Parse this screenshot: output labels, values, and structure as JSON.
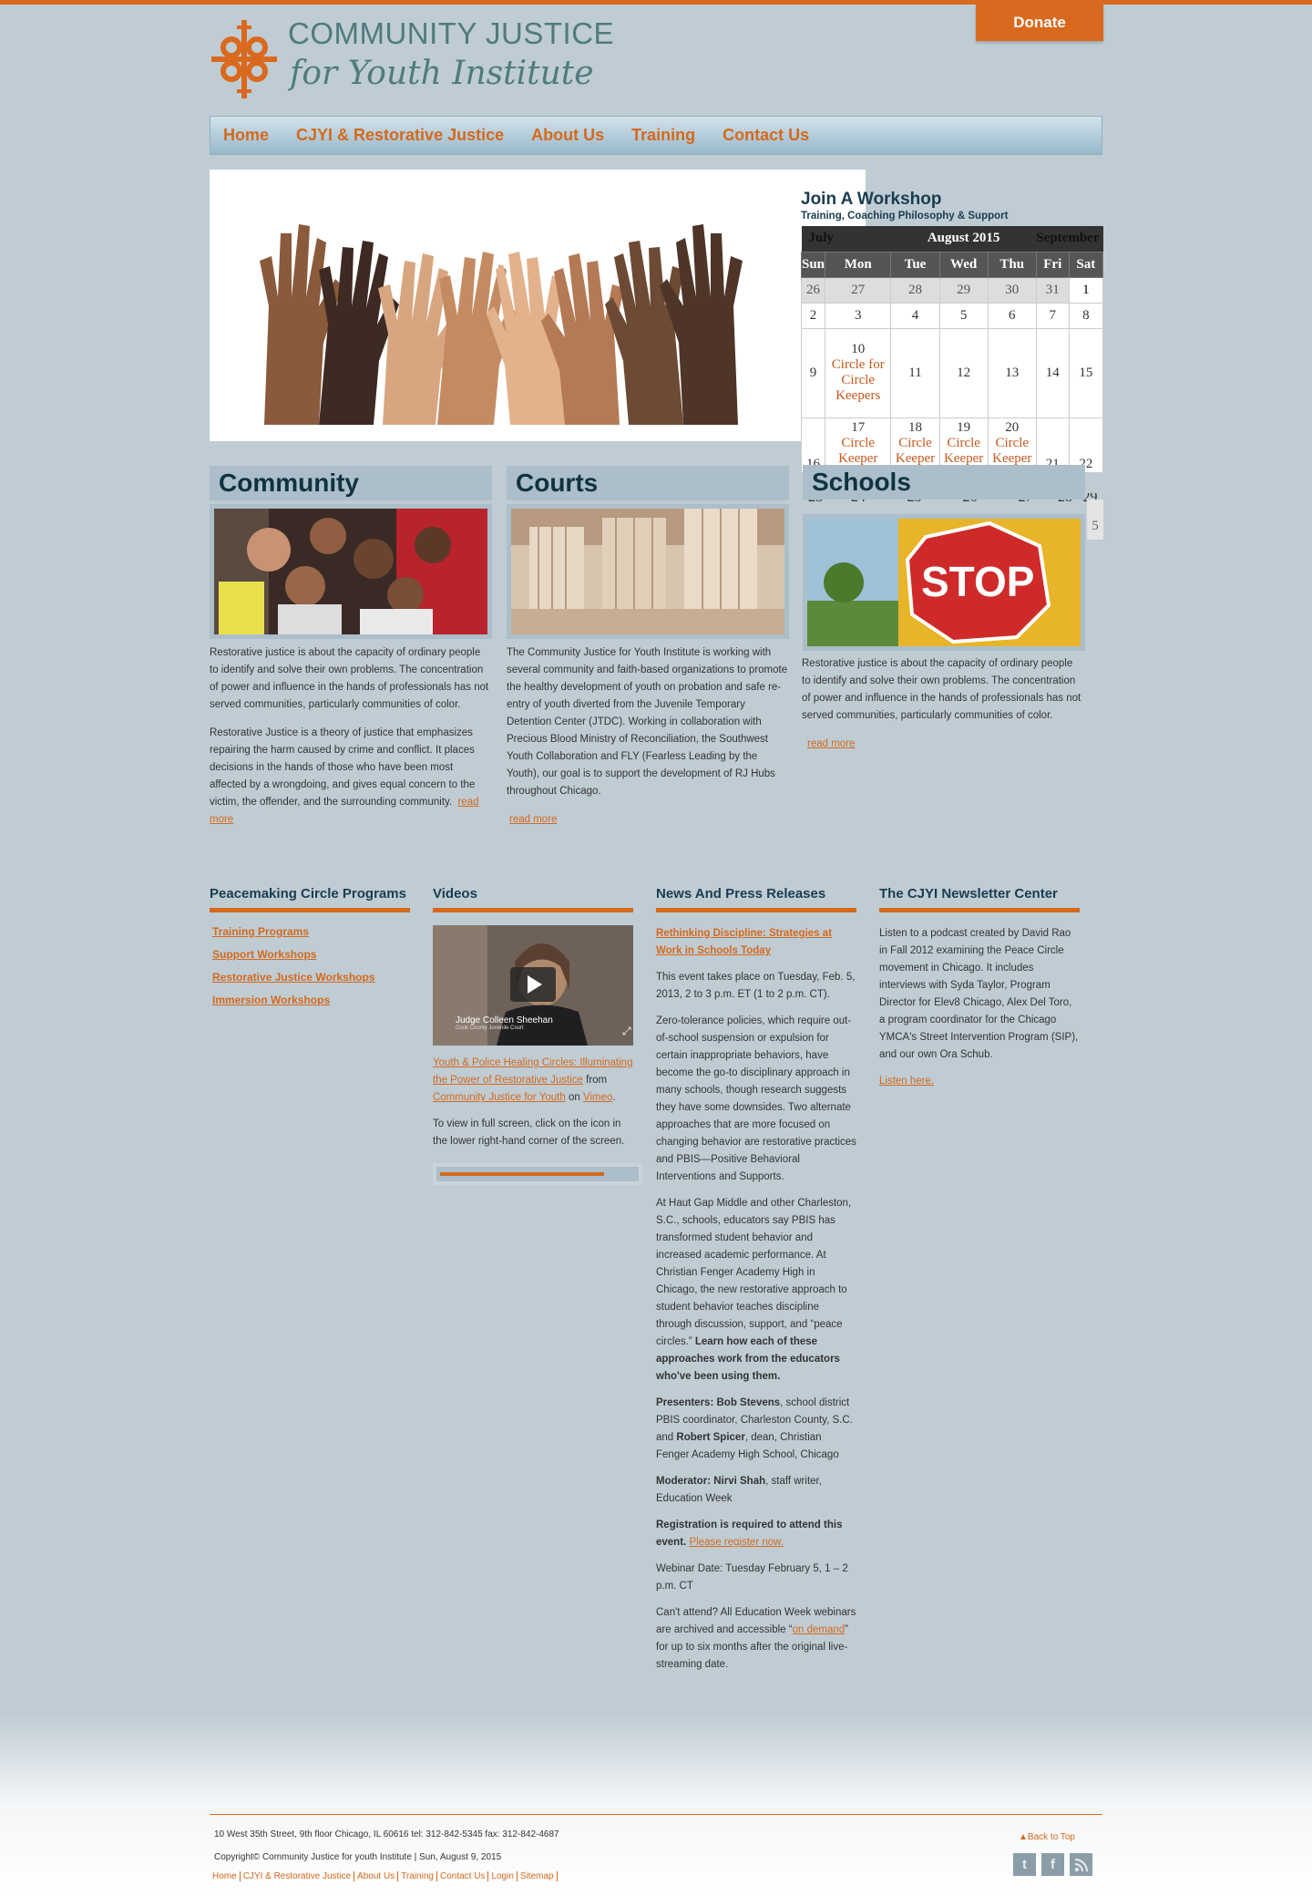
{
  "header": {
    "donate": "Donate",
    "logo_line1": "COMMUNITY JUSTICE",
    "logo_line2": "for Youth Institute"
  },
  "nav": [
    "Home",
    "CJYI & Restorative Justice",
    "About Us",
    "Training",
    "Contact Us"
  ],
  "workshop": {
    "title": "Join A Workshop",
    "subtitle": "Training, Coaching Philosophy & Support"
  },
  "calendar": {
    "prev": "July",
    "month": "August 2015",
    "next": "September",
    "days": [
      "Sun",
      "Mon",
      "Tue",
      "Wed",
      "Thu",
      "Fri",
      "Sat"
    ],
    "weeks": [
      [
        "26",
        "27",
        "28",
        "29",
        "30",
        "31",
        "1"
      ],
      [
        "2",
        "3",
        "4",
        "5",
        "6",
        "7",
        "8"
      ],
      [
        "9",
        "10",
        "11",
        "12",
        "13",
        "14",
        "15"
      ],
      [
        "16",
        "17",
        "18",
        "19",
        "20",
        "21",
        "22"
      ],
      [
        "23",
        "24",
        "25",
        "26",
        "27",
        "28",
        "29"
      ]
    ],
    "event_10": "Circle for Circle Keepers",
    "event_short": "Circle Keeper",
    "tail": "5"
  },
  "columns": {
    "community": {
      "title": "Community",
      "p1": "Restorative justice is about the capacity of ordinary people to identify and solve their own problems. The concentration of power and influence in the hands of professionals has not served communities, particularly communities of color.",
      "p2": "Restorative Justice is a theory of justice that emphasizes repairing the harm caused by crime and conflict. It places decisions in the hands of those who have been most affected by a wrongdoing, and gives equal concern to the victim, the offender, and the surrounding community.",
      "more": "read more"
    },
    "courts": {
      "title": "Courts",
      "p1": "The Community Justice for Youth Institute is working with several community and faith-based organizations to promote the healthy development of youth on probation and safe re-entry of youth diverted from the Juvenile Temporary Detention Center (JTDC).  Working in collaboration with Precious Blood Ministry of Reconciliation, the Southwest Youth Collaboration and FLY (Fearless Leading by the Youth), our goal is to support the development of RJ Hubs throughout Chicago.",
      "more": "read more"
    },
    "schools": {
      "title": "Schools",
      "p1": "Restorative justice is about the capacity of ordinary people to identify and solve their own problems. The concentration of power and influence in the hands of professionals has not served communities, particularly communities of color.",
      "more": "read more"
    }
  },
  "programs": {
    "title": "Peacemaking Circle Programs",
    "links": [
      "Training Programs",
      "Support Workshops",
      "Restorative Justice Workshops",
      "Immersion Workshops"
    ]
  },
  "videos": {
    "title": "Videos",
    "caption_name": "Judge Colleen Sheehan",
    "caption_sub": "Cook County Juvenile Court",
    "link": "Youth & Police Healing Circles: Illuminating the Power of Restorative Justice",
    "from": "from",
    "org": "Community Justice for Youth",
    "on": "on",
    "vimeo": "Vimeo",
    "note": "To view in full screen, click on the icon in the lower right-hand corner of the screen."
  },
  "news": {
    "title": "News And Press Releases",
    "headline": "Rethinking Discipline: Strategies at Work in Schools Today",
    "p1": "This event takes place on Tuesday, Feb. 5, 2013, 2 to 3 p.m. ET (1 to 2 p.m. CT).",
    "p2": "Zero-tolerance policies, which require out-of-school suspension or expulsion for certain inappropriate behaviors, have become the go-to disciplinary approach in many schools, though research suggests they have some downsides. Two alternate approaches that are more focused on changing behavior are restorative practices and PBIS—Positive Behavioral Interventions and Supports.",
    "p3": "At Haut Gap Middle and other Charleston, S.C., schools, educators say PBIS has transformed student behavior and increased academic performance. At Christian Fenger Academy High in Chicago, the new restorative approach to student behavior teaches discipline through discussion, support, and “peace circles.”",
    "p3_bold": "Learn how each of these approaches work from the educators who've been using them.",
    "presenters_label": "Presenters:",
    "presenter1": "Bob Stevens",
    "presenter1_role": ", school district PBIS coordinator, Charleston County, S.C. and ",
    "presenter2": "Robert Spicer",
    "presenter2_role": ", dean, Christian Fenger Academy High School, Chicago",
    "moderator_label": "Moderator: Nirvi Shah",
    "moderator_role": ", staff writer, Education Week",
    "registration_bold": "Registration is required to attend this event.",
    "register_link": "Please register now.",
    "webinar": "Webinar Date: Tuesday February 5, 1 – 2 p.m. CT",
    "cant_pre": "Can't attend? All Education Week webinars are archived and accessible “",
    "on_demand": "on demand",
    "cant_post": "” for up to six months after the original live-streaming date."
  },
  "newsletter": {
    "title": "The CJYI Newsletter Center",
    "text": "Listen to a podcast created by David Rao in Fall 2012 examining the Peace Circle movement in Chicago. It includes interviews with Syda Taylor, Program Director for Elev8 Chicago, Alex Del Toro, a program coordinator for the Chicago YMCA's Street Intervention Program (SIP), and our own Ora Schub.",
    "link": "Listen here."
  },
  "footer": {
    "address": "10 West 35th Street, 9th floor Chicago, IL 60616 tel: 312-842-5345 fax: 312-842-4687",
    "copyright": "Copyright© Community Justice for youth Institute | Sun, August 9, 2015",
    "links": [
      "Home",
      "CJYI & Restorative Justice",
      "About Us",
      "Training",
      "Contact Us",
      "Login",
      "Sitemap"
    ],
    "back_to_top": "Back to Top",
    "social": [
      "t",
      "f",
      "rss"
    ]
  },
  "colors": {
    "accent": "#d4691c",
    "background": "#bfccd4",
    "heading": "#1b3d4f"
  }
}
